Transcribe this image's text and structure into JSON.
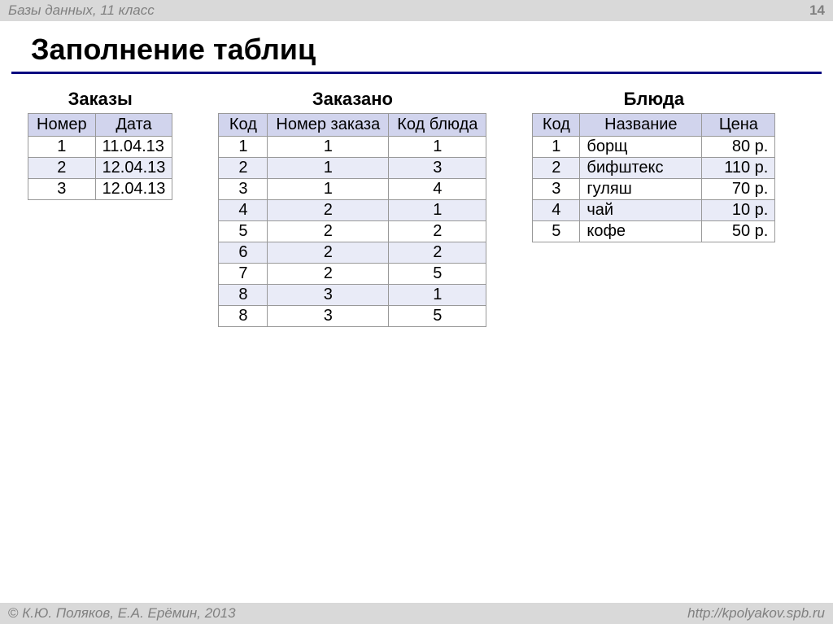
{
  "header": {
    "subject": "Базы данных, 11 класс",
    "page": "14"
  },
  "title": "Заполнение таблиц",
  "tables": {
    "orders": {
      "caption": "Заказы",
      "headers": [
        "Номер",
        "Дата"
      ],
      "rows": [
        [
          "1",
          "11.04.13"
        ],
        [
          "2",
          "12.04.13"
        ],
        [
          "3",
          "12.04.13"
        ]
      ]
    },
    "ordered": {
      "caption": "Заказано",
      "headers": [
        "Код",
        "Номер заказа",
        "Код блюда"
      ],
      "rows": [
        [
          "1",
          "1",
          "1"
        ],
        [
          "2",
          "1",
          "3"
        ],
        [
          "3",
          "1",
          "4"
        ],
        [
          "4",
          "2",
          "1"
        ],
        [
          "5",
          "2",
          "2"
        ],
        [
          "6",
          "2",
          "2"
        ],
        [
          "7",
          "2",
          "5"
        ],
        [
          "8",
          "3",
          "1"
        ],
        [
          "8",
          "3",
          "5"
        ]
      ]
    },
    "dishes": {
      "caption": "Блюда",
      "headers": [
        "Код",
        "Название",
        "Цена"
      ],
      "rows": [
        [
          "1",
          "борщ",
          "80 р."
        ],
        [
          "2",
          "бифштекс",
          "110 р."
        ],
        [
          "3",
          "гуляш",
          "70 р."
        ],
        [
          "4",
          "чай",
          "10 р."
        ],
        [
          "5",
          "кофе",
          "50 р."
        ]
      ]
    }
  },
  "footer": {
    "copyright_symbol": "©",
    "authors": " К.Ю. Поляков, Е.А. Ерёмин, 2013",
    "url": "http://kpolyakov.spb.ru"
  }
}
